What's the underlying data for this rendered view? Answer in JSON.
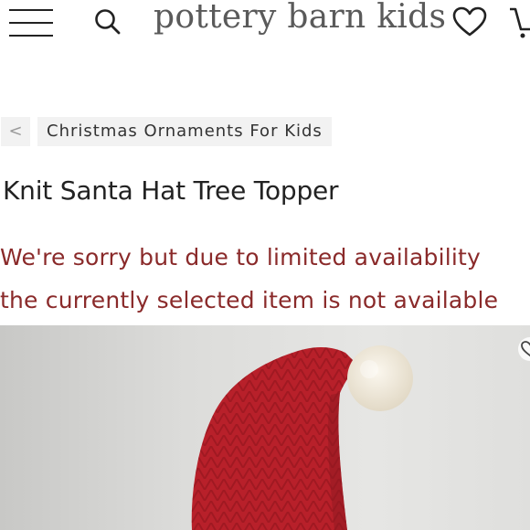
{
  "header": {
    "logo_text": "pottery barn kids"
  },
  "breadcrumb": {
    "back_label": "<",
    "category_label": "Christmas Ornaments For Kids"
  },
  "product": {
    "title": "Knit Santa Hat Tree Topper",
    "availability_line_1": "We're sorry but due to limited availability",
    "availability_line_2": "the currently selected item is not available"
  },
  "colors": {
    "notice_red": "#8a2a2a",
    "hat_red": "#b8202a",
    "pompom_cream": "#f1ebdd"
  },
  "icons": [
    "menu-icon",
    "search-icon",
    "heart-icon",
    "cart-icon",
    "favorite-icon"
  ]
}
